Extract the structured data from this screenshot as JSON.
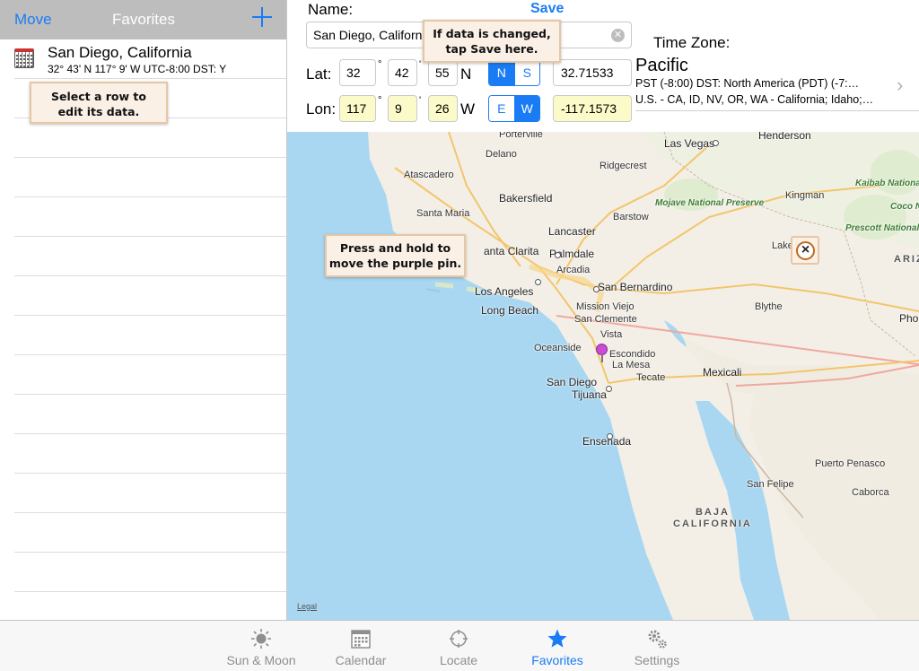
{
  "nav": {
    "move_label": "Move",
    "title": "Favorites",
    "add_icon": "plus-icon"
  },
  "favorites": [
    {
      "name": "San Diego, California",
      "detail": "32° 43' N   117° 9' W   UTC-8:00   DST: Y",
      "icon": "calendar-icon"
    }
  ],
  "notes": {
    "select_row": "Select a row to\nedit its data.",
    "save_hint": "If data is changed,\ntap Save here.",
    "pin_hint": "Press and hold to\nmove the purple pin."
  },
  "form": {
    "name_label": "Name:",
    "save_label": "Save",
    "name_value": "San Diego, California",
    "lat_label": "Lat:",
    "lat_deg": "32",
    "lat_min": "42",
    "lat_sec": "55",
    "lat_hemi": "N",
    "lat_toggle": [
      "N",
      "S"
    ],
    "lat_selected": "N",
    "lat_decimal": "32.71533",
    "lon_label": "Lon:",
    "lon_deg": "117",
    "lon_min": "9",
    "lon_sec": "26",
    "lon_hemi": "W",
    "lon_toggle": [
      "E",
      "W"
    ],
    "lon_selected": "W",
    "lon_decimal": "-117.1573",
    "deg_symbol": "°",
    "min_symbol": "'",
    "sec_symbol": "\""
  },
  "timezone": {
    "title": "Time Zone:",
    "zone": "Pacific",
    "line1": "PST (-8:00)  DST: North America (PDT) (-7:…",
    "line2": "U.S. - CA, ID, NV, OR, WA - California; Idaho;…"
  },
  "map": {
    "legal": "Legal",
    "places": {
      "porterville": "Porterville",
      "las_vegas": "Las Vegas",
      "henderson": "Henderson",
      "delano": "Delano",
      "atascadero": "Atascadero",
      "ridgecrest": "Ridgecrest",
      "kaibab": "Kaibab National Forest",
      "kingman": "Kingman",
      "bakersfield": "Bakersfield",
      "mojave": "Mojave National Preserve",
      "santa_maria": "Santa Maria",
      "barstow": "Barstow",
      "coconino": "Coco Nation",
      "prescott": "Prescott National Forest",
      "lancaster": "Lancaster",
      "lake_city": "Lake City",
      "santa_clarita": "anta Clarita",
      "palmdale": "Palmdale",
      "ariz": "ARIZ",
      "arcadia": "Arcadia",
      "los_angeles": "Los Angeles",
      "san_bernardino": "San Bernardino",
      "mission_viejo": "Mission Viejo",
      "long_beach": "Long Beach",
      "blythe": "Blythe",
      "phoenix": "Pho",
      "san_clemente": "San Clemente",
      "vista": "Vista",
      "oceanside": "Oceanside",
      "escondido": "Escondido",
      "la_mesa": "La Mesa",
      "mexicali": "Mexicali",
      "tecate": "Tecate",
      "san_diego": "San Diego",
      "tijuana": "Tijuana",
      "ensenada": "Ensenada",
      "puerto_penasco": "Puerto Penasco",
      "san_felipe": "San Felipe",
      "caborca": "Caborca",
      "baja": "BAJA\nCALIFORNIA"
    }
  },
  "tabs": [
    {
      "label": "Sun & Moon",
      "icon": "sun-icon",
      "active": false
    },
    {
      "label": "Calendar",
      "icon": "calendar-icon",
      "active": false
    },
    {
      "label": "Locate",
      "icon": "crosshair-icon",
      "active": false
    },
    {
      "label": "Favorites",
      "icon": "star-icon",
      "active": true
    },
    {
      "label": "Settings",
      "icon": "gear-icon",
      "active": false
    }
  ],
  "colors": {
    "accent": "#1a7cf5",
    "note_bg": "#faf0e6",
    "field_yellow": "#fbfbc9",
    "pin": "#c94bd6"
  }
}
